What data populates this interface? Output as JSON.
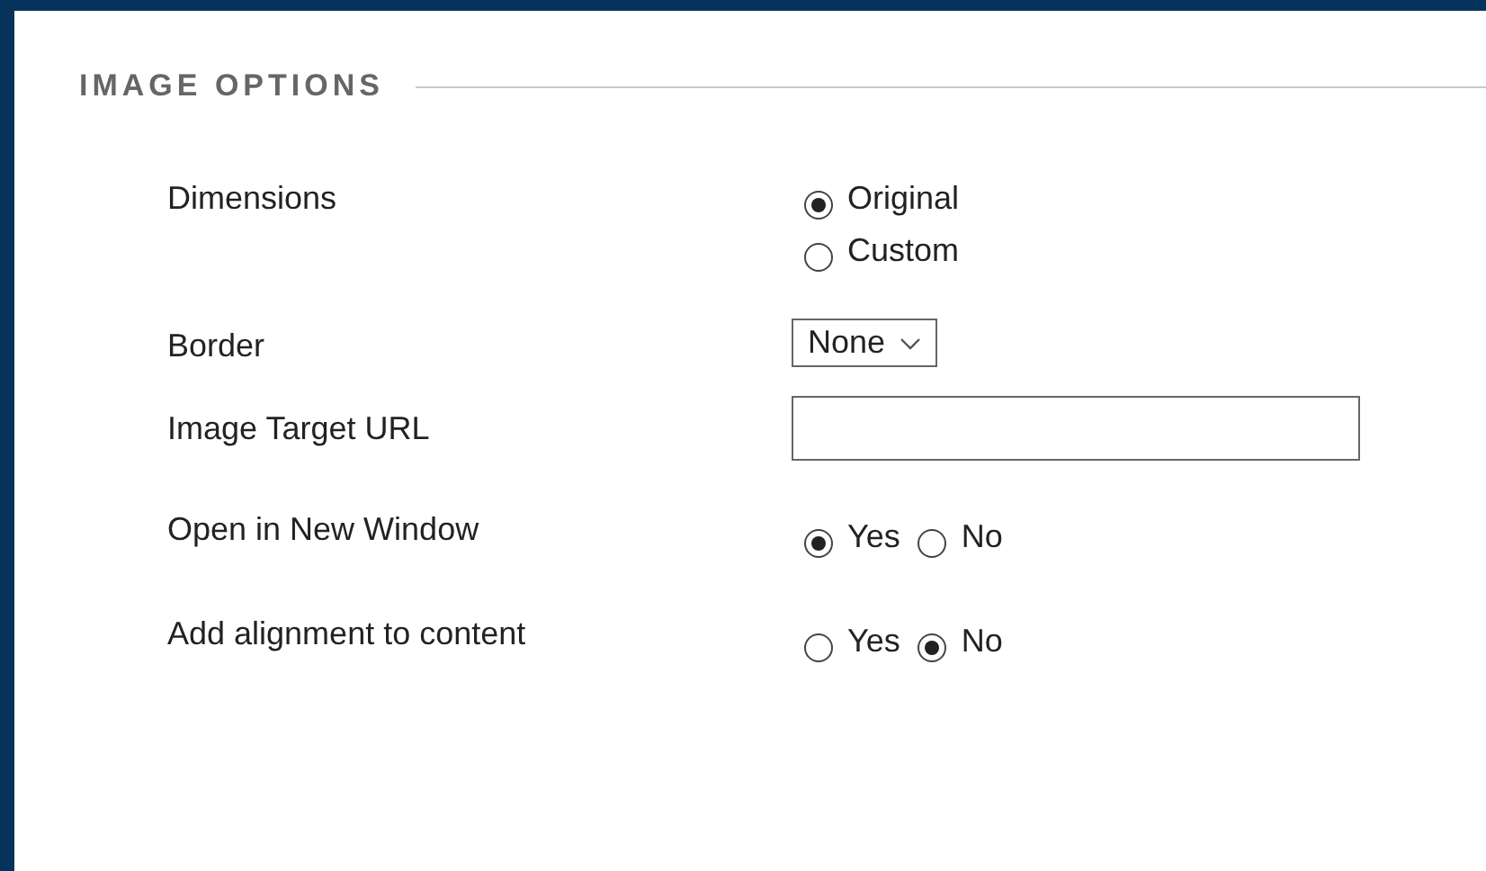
{
  "section": {
    "title": "IMAGE OPTIONS"
  },
  "rows": [
    {
      "label": "Dimensions",
      "kind": "radio-stack",
      "options": [
        {
          "label": "Original",
          "selected": true
        },
        {
          "label": "Custom",
          "selected": false
        }
      ]
    },
    {
      "label": "Border",
      "kind": "select",
      "value": "None"
    },
    {
      "label": "Image Target URL",
      "kind": "text"
    },
    {
      "label": "Open in New Window",
      "kind": "radio-inline",
      "options": [
        {
          "label": "Yes",
          "selected": true
        },
        {
          "label": "No",
          "selected": false
        }
      ]
    },
    {
      "label": "Add alignment to content",
      "kind": "radio-inline",
      "options": [
        {
          "label": "Yes",
          "selected": false
        },
        {
          "label": "No",
          "selected": true
        }
      ]
    }
  ]
}
